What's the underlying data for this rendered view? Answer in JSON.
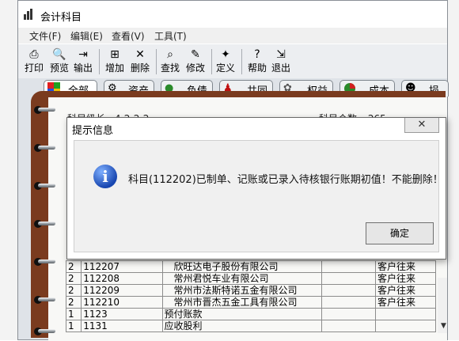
{
  "window": {
    "title": "会计科目"
  },
  "menu": [
    "文件(F)",
    "编辑(E)",
    "查看(V)",
    "工具(T)"
  ],
  "toolbar": [
    {
      "label": "打印",
      "icon": "printer-icon"
    },
    {
      "label": "预览",
      "icon": "preview-icon"
    },
    {
      "label": "输出",
      "icon": "export-icon"
    },
    {
      "label": "增加",
      "icon": "add-icon"
    },
    {
      "label": "删除",
      "icon": "delete-icon"
    },
    {
      "label": "查找",
      "icon": "find-icon"
    },
    {
      "label": "修改",
      "icon": "edit-icon"
    },
    {
      "label": "定义",
      "icon": "define-icon"
    },
    {
      "label": "帮助",
      "icon": "help-icon"
    },
    {
      "label": "退出",
      "icon": "exit-icon"
    }
  ],
  "tabs": [
    {
      "label": "全部",
      "icon": "all-icon",
      "active": true
    },
    {
      "label": "资产",
      "icon": "assets-icon"
    },
    {
      "label": "负债",
      "icon": "liabilities-icon"
    },
    {
      "label": "共同",
      "icon": "common-icon"
    },
    {
      "label": "权益",
      "icon": "equity-icon"
    },
    {
      "label": "成本",
      "icon": "cost-icon"
    },
    {
      "label": "损益",
      "icon": "profit-loss-icon"
    }
  ],
  "summary": {
    "level_label": "科目级长",
    "level_value": "4-2-2-2",
    "count_label": "科目个数",
    "count_value": "265"
  },
  "rows": [
    {
      "level": "2",
      "code": "112207",
      "name": "欣旺达电子股份有限公司",
      "type": "客户往来"
    },
    {
      "level": "2",
      "code": "112208",
      "name": "常州君悦车业有限公司",
      "type": "客户往来"
    },
    {
      "level": "2",
      "code": "112209",
      "name": "常州市法斯特诺五金有限公司",
      "type": "客户往来"
    },
    {
      "level": "2",
      "code": "112210",
      "name": "常州市晋杰五金工具有限公司",
      "type": "客户往来"
    },
    {
      "level": "1",
      "code": "1123",
      "name": "预付账款",
      "type": ""
    },
    {
      "level": "1",
      "code": "1131",
      "name": "应收股利",
      "type": ""
    }
  ],
  "dialog": {
    "title": "提示信息",
    "message": "科目(112202)已制单、记账或已录入待核银行账期初值！不能删除！",
    "ok_label": "确定",
    "close_symbol": "✕"
  }
}
